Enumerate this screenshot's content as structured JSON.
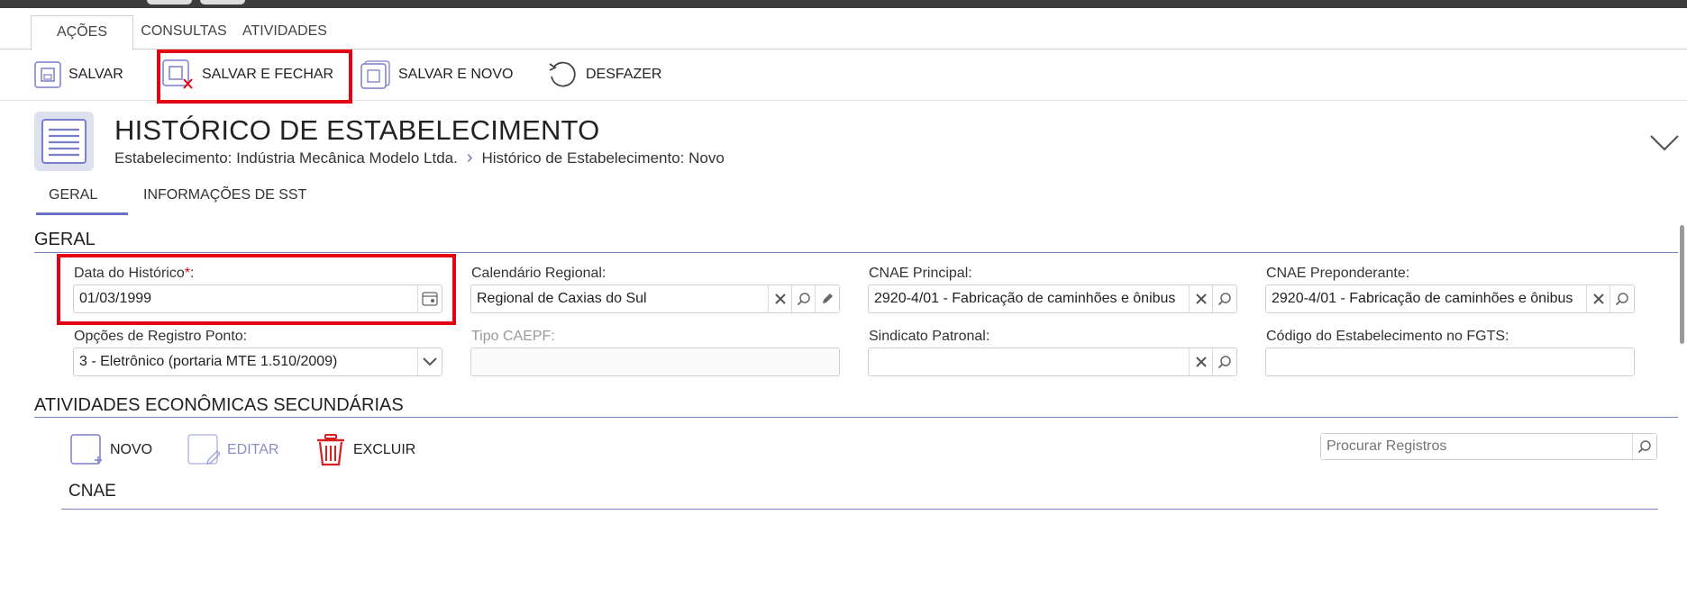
{
  "tabs": [
    {
      "label": "AÇÕES",
      "active": true
    },
    {
      "label": "CONSULTAS",
      "active": false
    },
    {
      "label": "ATIVIDADES",
      "active": false
    }
  ],
  "toolbar": {
    "save": "SALVAR",
    "save_close": "SALVAR E FECHAR",
    "save_new": "SALVAR E NOVO",
    "undo": "DESFAZER"
  },
  "header": {
    "title": "HISTÓRICO DE ESTABELECIMENTO",
    "breadcrumb": [
      "Estabelecimento: Indústria Mecânica Modelo Ltda.",
      "Histórico de Estabelecimento: Novo"
    ]
  },
  "subtabs": [
    "GERAL",
    "INFORMAÇÕES DE SST"
  ],
  "form": {
    "section_title": "GERAL",
    "data_historico": {
      "label": "Data do Histórico",
      "required_mark": "*",
      "suffix": ":",
      "value": "01/03/1999"
    },
    "calendario_regional": {
      "label": "Calendário Regional:",
      "value": "Regional de Caxias do Sul"
    },
    "cnae_principal": {
      "label": "CNAE Principal:",
      "value": "2920-4/01 - Fabricação de caminhões e ônibus"
    },
    "cnae_preponderante": {
      "label": "CNAE Preponderante:",
      "value": "2920-4/01 - Fabricação de caminhões e ônibus"
    },
    "opcoes_registro_ponto": {
      "label": "Opções de Registro Ponto:",
      "value": "3 - Eletrônico (portaria MTE 1.510/2009)"
    },
    "tipo_caepf": {
      "label": "Tipo CAEPF:",
      "value": ""
    },
    "sindicato_patronal": {
      "label": "Sindicato Patronal:",
      "value": ""
    },
    "codigo_fgts": {
      "label": "Código do Estabelecimento no FGTS:",
      "value": ""
    }
  },
  "secondary": {
    "section_title": "ATIVIDADES ECONÔMICAS SECUNDÁRIAS",
    "new": "NOVO",
    "edit": "EDITAR",
    "delete": "EXCLUIR",
    "search_placeholder": "Procurar Registros",
    "column_header": "CNAE"
  },
  "colors": {
    "accent": "#6b6fc7",
    "highlight": "#e60012",
    "delete": "#d42020"
  }
}
